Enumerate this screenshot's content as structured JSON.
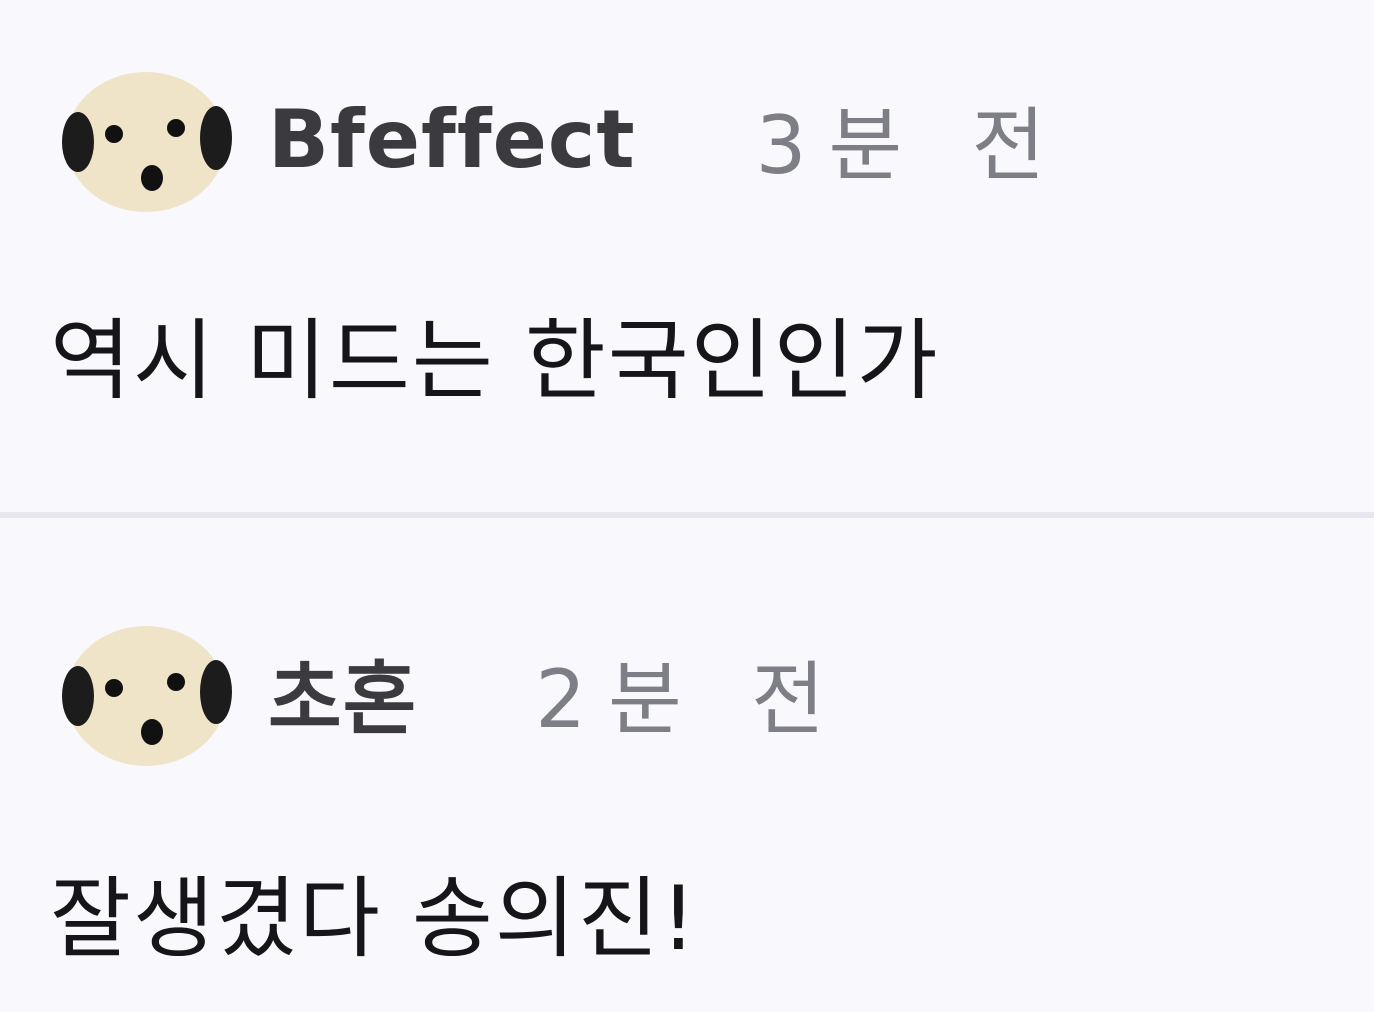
{
  "comments": [
    {
      "username": "Bfeffect",
      "timestamp": "3분 전",
      "text": "역시 미드는 한국인인가",
      "avatar_icon": "puppy-face-icon"
    },
    {
      "username": "초혼",
      "timestamp": "2분 전",
      "text": "잘생겼다 송의진!",
      "avatar_icon": "puppy-face-icon"
    }
  ],
  "colors": {
    "background": "#f8f8fd",
    "divider": "#e6e6ee",
    "username": "#3a3a3f",
    "timestamp": "#7e7e86",
    "text": "#16161a"
  }
}
